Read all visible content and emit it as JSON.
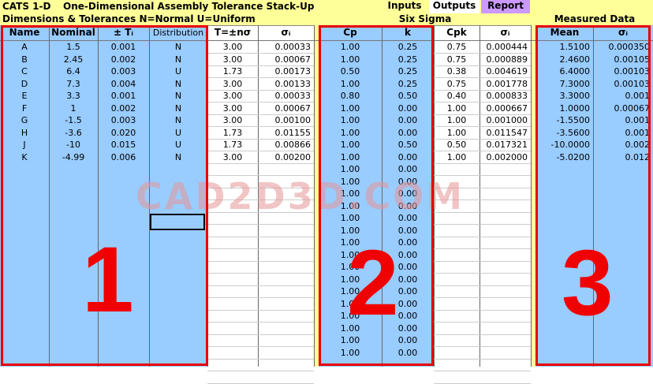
{
  "app": {
    "title": "CATS 1-D",
    "subtitle": "One-Dimensional Assembly Tolerance Stack-Up",
    "tabs": [
      "Inputs",
      "Outputs",
      "Report"
    ]
  },
  "sections": {
    "dimensions": "Dimensions & Tolerances N=Normal U=Uniform",
    "six_sigma": "Six Sigma",
    "measured": "Measured Data"
  },
  "columns": {
    "name": "Name",
    "nominal": "Nominal",
    "tol": "± Tᵢ",
    "dist": "Distribution",
    "T": "T=±nσ",
    "sigma1": "σᵢ",
    "cp": "Cp",
    "k": "k",
    "cpk": "Cpk",
    "sigma2": "σᵢ",
    "mean": "Mean",
    "sigma3": "σᵢ"
  },
  "rows": [
    {
      "name": "A",
      "nominal": "1.5",
      "tol": "0.001",
      "dist": "N",
      "T": "3.00",
      "sigma": "0.00033",
      "cp": "1.00",
      "k": "0.25",
      "cpk": "0.75",
      "s2": "0.000444",
      "mean": "1.5100",
      "s3": "0.000350"
    },
    {
      "name": "B",
      "nominal": "2.45",
      "tol": "0.002",
      "dist": "N",
      "T": "3.00",
      "sigma": "0.00067",
      "cp": "1.00",
      "k": "0.25",
      "cpk": "0.75",
      "s2": "0.000889",
      "mean": "2.4600",
      "s3": "0.00105"
    },
    {
      "name": "C",
      "nominal": "6.4",
      "tol": "0.003",
      "dist": "U",
      "T": "1.73",
      "sigma": "0.00173",
      "cp": "0.50",
      "k": "0.25",
      "cpk": "0.38",
      "s2": "0.004619",
      "mean": "6.4000",
      "s3": "0.00103"
    },
    {
      "name": "D",
      "nominal": "7.3",
      "tol": "0.004",
      "dist": "N",
      "T": "3.00",
      "sigma": "0.00133",
      "cp": "1.00",
      "k": "0.25",
      "cpk": "0.75",
      "s2": "0.001778",
      "mean": "7.3000",
      "s3": "0.00103"
    },
    {
      "name": "E",
      "nominal": "3.3",
      "tol": "0.001",
      "dist": "N",
      "T": "3.00",
      "sigma": "0.00033",
      "cp": "0.80",
      "k": "0.50",
      "cpk": "0.40",
      "s2": "0.000833",
      "mean": "3.3000",
      "s3": "0.001"
    },
    {
      "name": "F",
      "nominal": "1",
      "tol": "0.002",
      "dist": "N",
      "T": "3.00",
      "sigma": "0.00067",
      "cp": "1.00",
      "k": "0.00",
      "cpk": "1.00",
      "s2": "0.000667",
      "mean": "1.0000",
      "s3": "0.00067"
    },
    {
      "name": "G",
      "nominal": "-1.5",
      "tol": "0.003",
      "dist": "N",
      "T": "3.00",
      "sigma": "0.00100",
      "cp": "1.00",
      "k": "0.00",
      "cpk": "1.00",
      "s2": "0.001000",
      "mean": "-1.5500",
      "s3": "0.001"
    },
    {
      "name": "H",
      "nominal": "-3.6",
      "tol": "0.020",
      "dist": "U",
      "T": "1.73",
      "sigma": "0.01155",
      "cp": "1.00",
      "k": "0.00",
      "cpk": "1.00",
      "s2": "0.011547",
      "mean": "-3.5600",
      "s3": "0.001"
    },
    {
      "name": "J",
      "nominal": "-10",
      "tol": "0.015",
      "dist": "U",
      "T": "1.73",
      "sigma": "0.00866",
      "cp": "1.00",
      "k": "0.50",
      "cpk": "0.50",
      "s2": "0.017321",
      "mean": "-10.0000",
      "s3": "0.002"
    },
    {
      "name": "K",
      "nominal": "-4.99",
      "tol": "0.006",
      "dist": "N",
      "T": "3.00",
      "sigma": "0.00200",
      "cp": "1.00",
      "k": "0.00",
      "cpk": "1.00",
      "s2": "0.002000",
      "mean": "-5.0200",
      "s3": "0.012"
    }
  ],
  "extra_rows": {
    "cp": "1.00",
    "k": "0.00",
    "count": 16
  },
  "annotations": {
    "watermark": "CAD2D3D.COM",
    "labels": [
      "1",
      "2",
      "3"
    ]
  },
  "colors": {
    "title_bar": "#ffff99",
    "blue": "#99ccff",
    "report_tab": "#cc99ff",
    "highlight": "#e60000"
  }
}
